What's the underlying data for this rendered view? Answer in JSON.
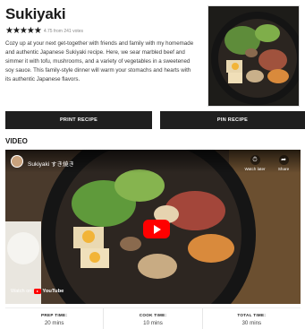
{
  "recipe": {
    "title": "Sukiyaki",
    "stars": "★★★★★",
    "rating_text": "4.75 from 241 votes",
    "description": "Cozy up at your next get-together with friends and family with my homemade and authentic Japanese Sukiyaki recipe. Here, we sear marbled beef and simmer it with tofu, mushrooms, and a variety of vegetables in a sweetened soy sauce. This family-style dinner will warm your stomachs and hearts with its authentic Japanese flavors."
  },
  "buttons": {
    "print_label": "PRINT RECIPE",
    "pin_label": "PIN RECIPE"
  },
  "video": {
    "section_heading": "VIDEO",
    "title": "Sukiyaki すき焼き",
    "watch_later_label": "Watch later",
    "share_label": "Share",
    "watch_on_label": "Watch on",
    "platform_label": "YouTube"
  },
  "times": [
    {
      "label": "PREP TIME:",
      "value": "20 mins"
    },
    {
      "label": "COOK TIME:",
      "value": "10 mins"
    },
    {
      "label": "TOTAL TIME:",
      "value": "30 mins"
    }
  ],
  "icons": {
    "clock": "clock-icon",
    "share": "share-icon",
    "play": "play-icon"
  },
  "colors": {
    "button_bg": "#1f1f1f",
    "youtube_red": "#ff0000"
  }
}
